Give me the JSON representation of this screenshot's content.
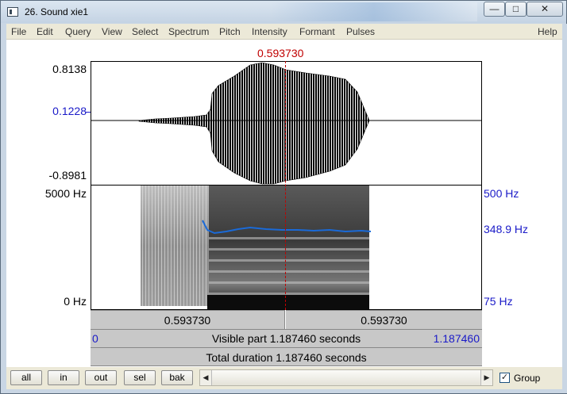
{
  "window": {
    "title": "26. Sound xie1",
    "controls": {
      "minimize": "—",
      "maximize": "□",
      "close": "✕"
    }
  },
  "menu": [
    "File",
    "Edit",
    "Query",
    "View",
    "Select",
    "Spectrum",
    "Pitch",
    "Intensity",
    "Formant",
    "Pulses",
    "Help"
  ],
  "cursor": {
    "time": "0.593730",
    "color": "#c00000"
  },
  "waveform": {
    "max": "0.8138",
    "value": "0.1228",
    "min": "-0.8981"
  },
  "spectrogram": {
    "top_freq": "5000 Hz",
    "bottom_freq": "0 Hz"
  },
  "pitch": {
    "top": "500 Hz",
    "current": "348.9 Hz",
    "bottom": "75 Hz",
    "color": "#1a6ad8"
  },
  "selection": {
    "left": "0.593730",
    "right": "0.593730"
  },
  "visible": {
    "start": "0",
    "label": "Visible part 1.187460 seconds",
    "end": "1.187460"
  },
  "total": {
    "label": "Total duration 1.187460 seconds"
  },
  "buttons": {
    "all": "all",
    "in": "in",
    "out": "out",
    "sel": "sel",
    "bak": "bak"
  },
  "scroll": {
    "left_arrow": "◀",
    "right_arrow": "▶"
  },
  "group": {
    "label": "Group",
    "checked": "✓"
  },
  "colors": {
    "label_blue": "#1a1ac8",
    "accent_red": "#c00000"
  }
}
